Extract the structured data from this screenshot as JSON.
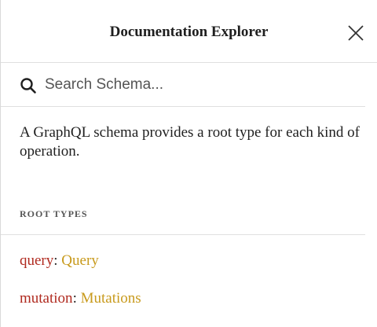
{
  "header": {
    "title": "Documentation Explorer",
    "close_icon": "close-icon"
  },
  "search": {
    "placeholder": "Search Schema...",
    "value": "",
    "icon": "search-icon"
  },
  "description": "A GraphQL schema provides a root type for each kind of operation.",
  "root_types": {
    "section_title": "ROOT TYPES",
    "items": [
      {
        "field": "query",
        "separator": ": ",
        "type": "Query"
      },
      {
        "field": "mutation",
        "separator": ": ",
        "type": "Mutations"
      }
    ]
  },
  "colors": {
    "field_name": "#b02a1f",
    "type_name": "#c89a1c",
    "divider": "#e0e0e0"
  }
}
